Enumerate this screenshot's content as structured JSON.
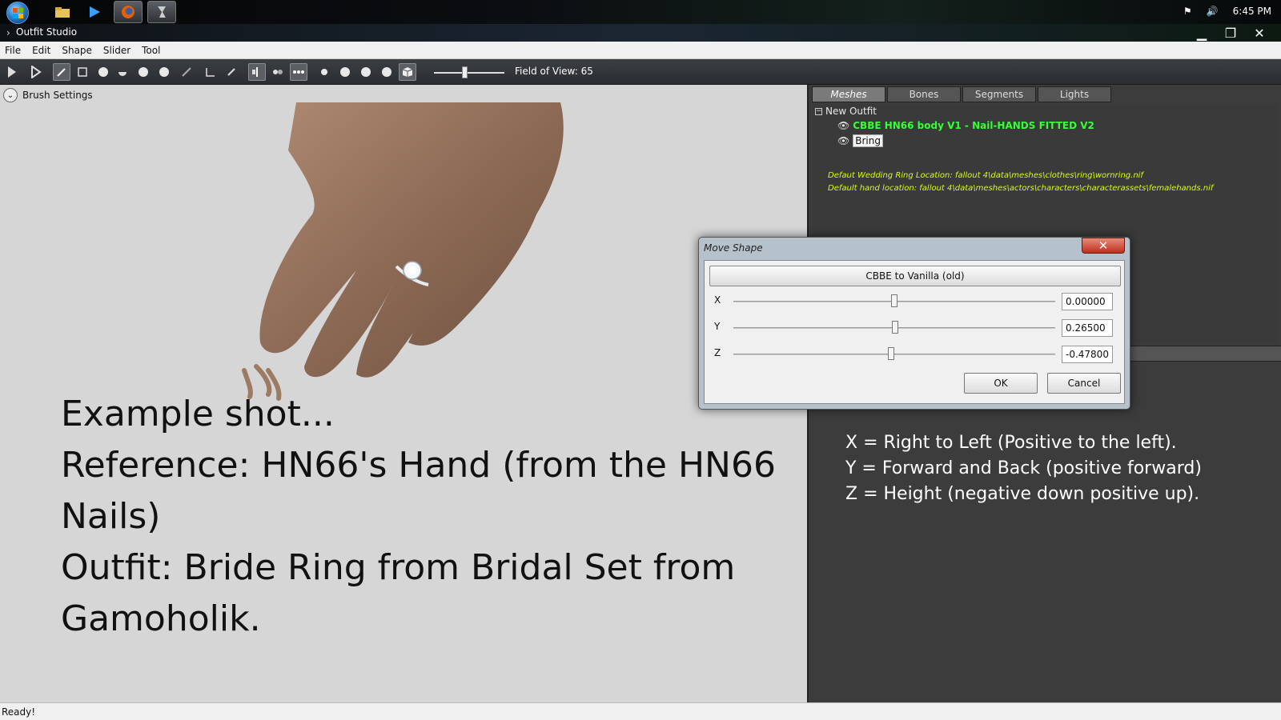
{
  "taskbar": {
    "time": "6:45 PM",
    "buttons": [
      "explorer-icon",
      "media-player-icon",
      "firefox-icon",
      "outfit-studio-icon"
    ]
  },
  "app": {
    "title": "Outfit Studio",
    "window_controls": {
      "minimize": "▁",
      "maximize": "❐",
      "close": "✕"
    }
  },
  "menu": {
    "items": [
      "File",
      "Edit",
      "Shape",
      "Slider",
      "Tool"
    ]
  },
  "toolbar": {
    "fov_label": "Field of View: 65",
    "fov_value": 65
  },
  "viewport": {
    "brush_settings": "Brush Settings",
    "lines": [
      "Example shot...",
      "Reference: HN66's Hand (from the HN66 Nails)",
      "Outfit: Bride Ring from Bridal Set from Gamoholik."
    ]
  },
  "panel": {
    "tabs": [
      "Meshes",
      "Bones",
      "Segments",
      "Lights"
    ],
    "active_tab": "Meshes",
    "root": "New Outfit",
    "meshes": [
      "CBBE HN66 body V1 - Nail-HANDS FITTED V2",
      "Bring"
    ],
    "notes": [
      "Defaut Wedding Ring Location: fallout 4\\data\\meshes\\clothes\\ring\\wornring.nif",
      "Default hand location: fallout 4\\data\\meshes\\actors\\characters\\characterassets\\femalehands.nif"
    ],
    "axis_help": [
      "X = Right to Left (Positive to the left).",
      "Y = Forward and Back (positive forward)",
      "Z = Height (negative down positive up)."
    ]
  },
  "dialog": {
    "title": "Move Shape",
    "close": "✕",
    "preset": "CBBE to Vanilla (old)",
    "axes": [
      {
        "label": "X",
        "value": "0.00000"
      },
      {
        "label": "Y",
        "value": "0.26500"
      },
      {
        "label": "Z",
        "value": "-0.47800"
      }
    ],
    "ok": "OK",
    "cancel": "Cancel"
  },
  "status": {
    "text": "Ready!"
  }
}
